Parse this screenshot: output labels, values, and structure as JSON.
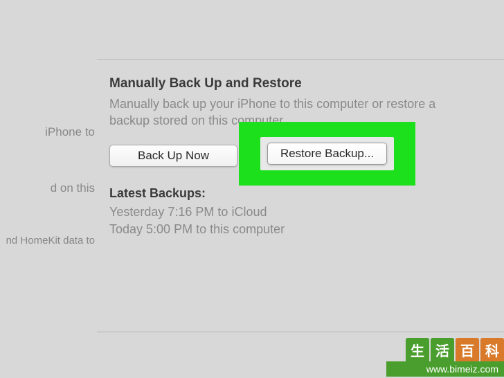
{
  "leftPanel": {
    "text1": "iPhone to",
    "text2": "d on this",
    "text3": "nd HomeKit data to"
  },
  "section": {
    "title": "Manually Back Up and Restore",
    "description": "Manually back up your iPhone to this computer or restore a backup stored on this computer."
  },
  "buttons": {
    "backup": "Back Up Now",
    "restore": "Restore Backup..."
  },
  "latest": {
    "title": "Latest Backups:",
    "line1": "Yesterday 7:16 PM to iCloud",
    "line2": "Today 5:00 PM to this computer"
  },
  "watermark": {
    "char1": "生",
    "char2": "活",
    "char3": "百",
    "char4": "科",
    "url": "www.bimeiz.com"
  }
}
